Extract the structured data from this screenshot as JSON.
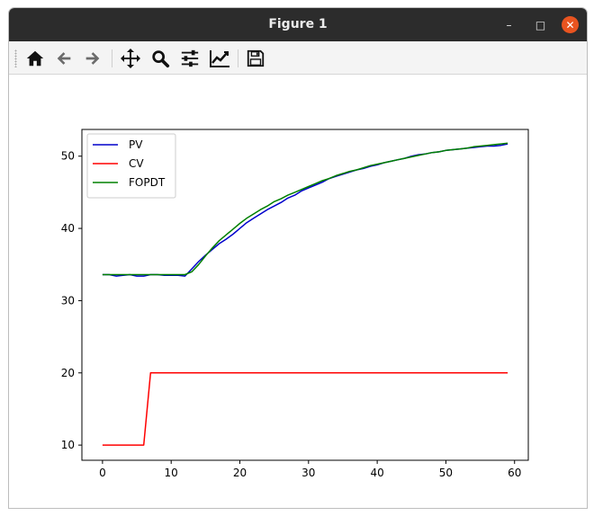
{
  "window": {
    "title": "Figure 1",
    "controls": {
      "minimize": "–",
      "maximize": "□",
      "close": "✕"
    }
  },
  "toolbar": {
    "buttons": [
      {
        "name": "home-button",
        "icon": "home-icon"
      },
      {
        "name": "back-button",
        "icon": "arrow-left-icon"
      },
      {
        "name": "forward-button",
        "icon": "arrow-right-icon"
      },
      {
        "name": "pan-button",
        "icon": "move-icon"
      },
      {
        "name": "zoom-button",
        "icon": "magnifier-icon"
      },
      {
        "name": "subplots-button",
        "icon": "sliders-icon"
      },
      {
        "name": "edit-axes-button",
        "icon": "line-chart-icon"
      },
      {
        "name": "save-button",
        "icon": "floppy-disk-icon"
      }
    ]
  },
  "chart_data": {
    "type": "line",
    "title": "",
    "xlabel": "",
    "ylabel": "",
    "xlim": [
      -3,
      62
    ],
    "ylim": [
      7.9,
      53.7
    ],
    "xticks": [
      0,
      10,
      20,
      30,
      40,
      50,
      60
    ],
    "yticks": [
      10,
      20,
      30,
      40,
      50
    ],
    "grid": false,
    "legend_position": "top-left",
    "series": [
      {
        "name": "PV",
        "color": "#0000cc",
        "x": [
          0,
          1,
          2,
          3,
          4,
          5,
          6,
          7,
          8,
          9,
          10,
          11,
          12,
          13,
          14,
          15,
          16,
          17,
          18,
          19,
          20,
          21,
          22,
          23,
          24,
          25,
          26,
          27,
          28,
          29,
          30,
          31,
          32,
          33,
          34,
          35,
          36,
          37,
          38,
          39,
          40,
          41,
          42,
          43,
          44,
          45,
          46,
          47,
          48,
          49,
          50,
          51,
          52,
          53,
          54,
          55,
          56,
          57,
          58,
          59
        ],
        "y": [
          33.6,
          33.6,
          33.4,
          33.5,
          33.6,
          33.4,
          33.4,
          33.6,
          33.6,
          33.5,
          33.5,
          33.5,
          33.4,
          34.4,
          35.4,
          36.3,
          37.1,
          37.9,
          38.5,
          39.2,
          40.0,
          40.8,
          41.4,
          42.0,
          42.6,
          43.1,
          43.6,
          44.2,
          44.6,
          45.2,
          45.6,
          46.0,
          46.4,
          46.9,
          47.2,
          47.5,
          47.8,
          48.1,
          48.3,
          48.6,
          48.8,
          49.1,
          49.3,
          49.5,
          49.7,
          50.0,
          50.2,
          50.3,
          50.5,
          50.6,
          50.8,
          50.9,
          51.0,
          51.1,
          51.2,
          51.3,
          51.4,
          51.4,
          51.5,
          51.7
        ]
      },
      {
        "name": "CV",
        "color": "#ff0000",
        "x": [
          0,
          1,
          2,
          3,
          4,
          5,
          6,
          7,
          8,
          9,
          10,
          11,
          12,
          13,
          14,
          15,
          16,
          17,
          18,
          19,
          20,
          21,
          22,
          23,
          24,
          25,
          26,
          27,
          28,
          29,
          30,
          31,
          32,
          33,
          34,
          35,
          36,
          37,
          38,
          39,
          40,
          41,
          42,
          43,
          44,
          45,
          46,
          47,
          48,
          49,
          50,
          51,
          52,
          53,
          54,
          55,
          56,
          57,
          58,
          59
        ],
        "y": [
          10,
          10,
          10,
          10,
          10,
          10,
          10,
          20,
          20,
          20,
          20,
          20,
          20,
          20,
          20,
          20,
          20,
          20,
          20,
          20,
          20,
          20,
          20,
          20,
          20,
          20,
          20,
          20,
          20,
          20,
          20,
          20,
          20,
          20,
          20,
          20,
          20,
          20,
          20,
          20,
          20,
          20,
          20,
          20,
          20,
          20,
          20,
          20,
          20,
          20,
          20,
          20,
          20,
          20,
          20,
          20,
          20,
          20,
          20,
          20
        ]
      },
      {
        "name": "FOPDT",
        "color": "#008000",
        "x": [
          0,
          1,
          2,
          3,
          4,
          5,
          6,
          7,
          8,
          9,
          10,
          11,
          12,
          13,
          14,
          15,
          16,
          17,
          18,
          19,
          20,
          21,
          22,
          23,
          24,
          25,
          26,
          27,
          28,
          29,
          30,
          31,
          32,
          33,
          34,
          35,
          36,
          37,
          38,
          39,
          40,
          41,
          42,
          43,
          44,
          45,
          46,
          47,
          48,
          49,
          50,
          51,
          52,
          53,
          54,
          55,
          56,
          57,
          58,
          59
        ],
        "y": [
          33.6,
          33.6,
          33.6,
          33.6,
          33.6,
          33.6,
          33.6,
          33.6,
          33.6,
          33.6,
          33.6,
          33.6,
          33.6,
          34.0,
          35.0,
          36.2,
          37.3,
          38.3,
          39.1,
          39.9,
          40.7,
          41.4,
          42.0,
          42.6,
          43.1,
          43.7,
          44.1,
          44.6,
          45.0,
          45.4,
          45.8,
          46.2,
          46.6,
          46.9,
          47.3,
          47.6,
          47.9,
          48.1,
          48.4,
          48.7,
          48.9,
          49.1,
          49.3,
          49.5,
          49.7,
          49.9,
          50.1,
          50.3,
          50.5,
          50.6,
          50.8,
          50.9,
          51.0,
          51.1,
          51.3,
          51.4,
          51.5,
          51.6,
          51.7,
          51.8
        ]
      }
    ]
  }
}
